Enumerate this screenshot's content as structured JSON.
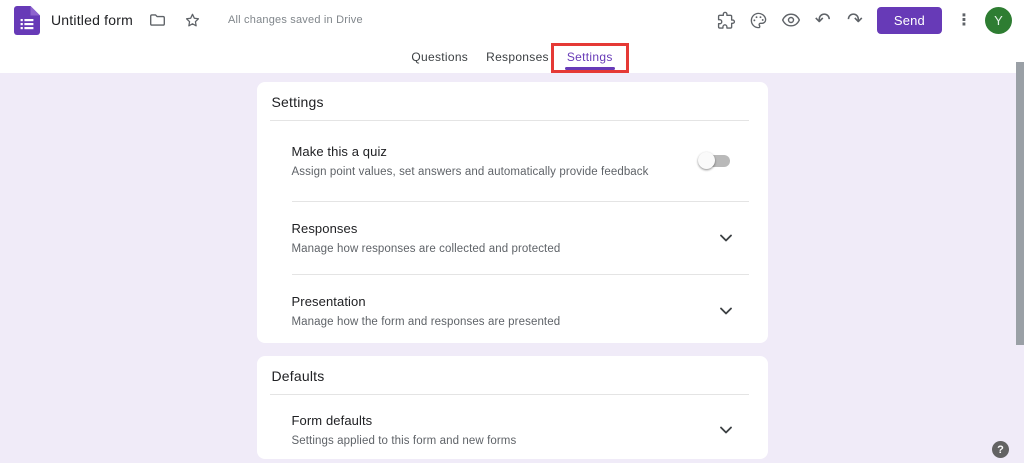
{
  "colors": {
    "brand_purple": "#673ab7",
    "page_background": "#f0ebf8",
    "annotation_red": "#e53935",
    "avatar_green": "#2e7d32"
  },
  "header": {
    "title": "Untitled form",
    "saved_status": "All changes saved in Drive",
    "icons": {
      "app": "forms-icon",
      "folder": "move-to-folder-icon",
      "star": "star-icon",
      "extensions": "puzzle-icon",
      "theme": "palette-icon",
      "preview": "eye-icon",
      "undo": "undo-icon",
      "redo": "redo-icon",
      "more": "kebab-menu-icon"
    },
    "undo_glyph": "↶",
    "redo_glyph": "↷",
    "more_glyph": "⋮",
    "send_label": "Send",
    "avatar_letter": "Y"
  },
  "tabs": {
    "questions": "Questions",
    "responses": "Responses",
    "settings": "Settings",
    "active_tab": "Settings",
    "highlight": "red-box-around-settings"
  },
  "settings_card": {
    "title": "Settings",
    "quiz_row": {
      "title": "Make this a quiz",
      "subtitle": "Assign point values, set answers and automatically provide feedback",
      "toggle_state": "off"
    },
    "rows": [
      {
        "title": "Responses",
        "subtitle": "Manage how responses are collected and protected"
      },
      {
        "title": "Presentation",
        "subtitle": "Manage how the form and responses are presented"
      }
    ]
  },
  "defaults_card": {
    "title": "Defaults",
    "rows": [
      {
        "title": "Form defaults",
        "subtitle": "Settings applied to this form and new forms"
      }
    ]
  },
  "help": {
    "glyph": "?"
  }
}
